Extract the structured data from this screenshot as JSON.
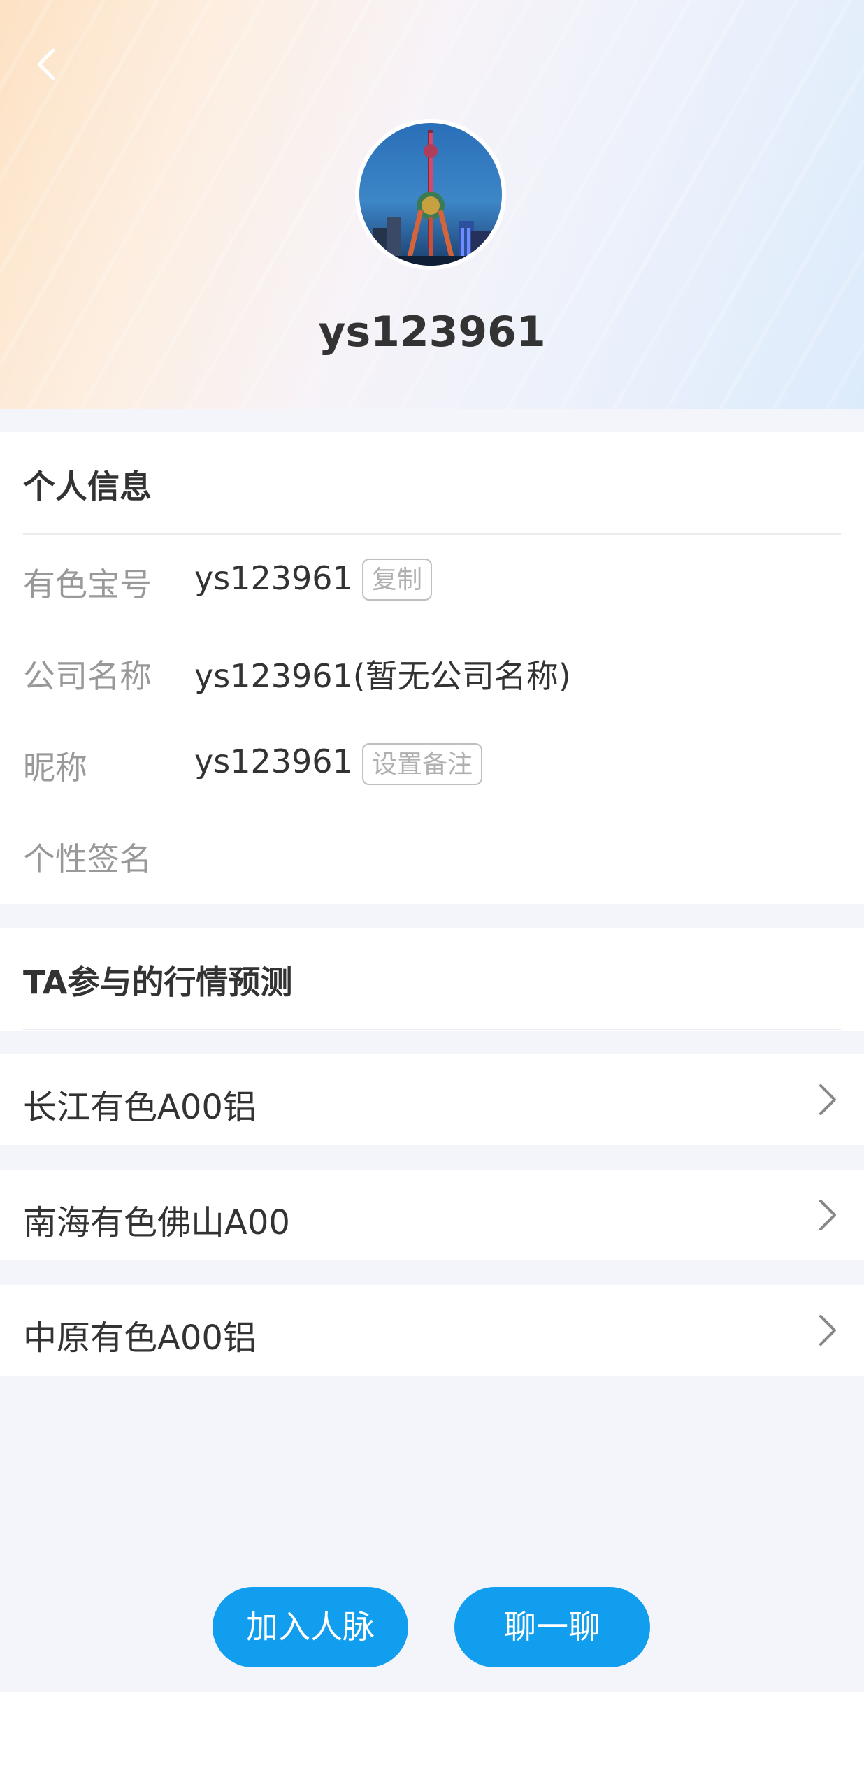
{
  "header": {
    "username": "ys123961"
  },
  "personal_info": {
    "title": "个人信息",
    "rows": [
      {
        "label": "有色宝号",
        "value": "ys123961",
        "button": "复制"
      },
      {
        "label": "公司名称",
        "value": "ys123961(暂无公司名称)"
      },
      {
        "label": "昵称",
        "value": "ys123961",
        "button": "设置备注"
      },
      {
        "label": "个性签名",
        "value": ""
      }
    ]
  },
  "predictions": {
    "title": "TA参与的行情预测",
    "items": [
      {
        "label": "长江有色A00铝"
      },
      {
        "label": "南海有色佛山A00"
      },
      {
        "label": "中原有色A00铝"
      }
    ]
  },
  "actions": {
    "add_contact": "加入人脉",
    "chat": "聊一聊"
  },
  "colors": {
    "accent": "#129eee",
    "page_background": "#f4f5fb"
  }
}
